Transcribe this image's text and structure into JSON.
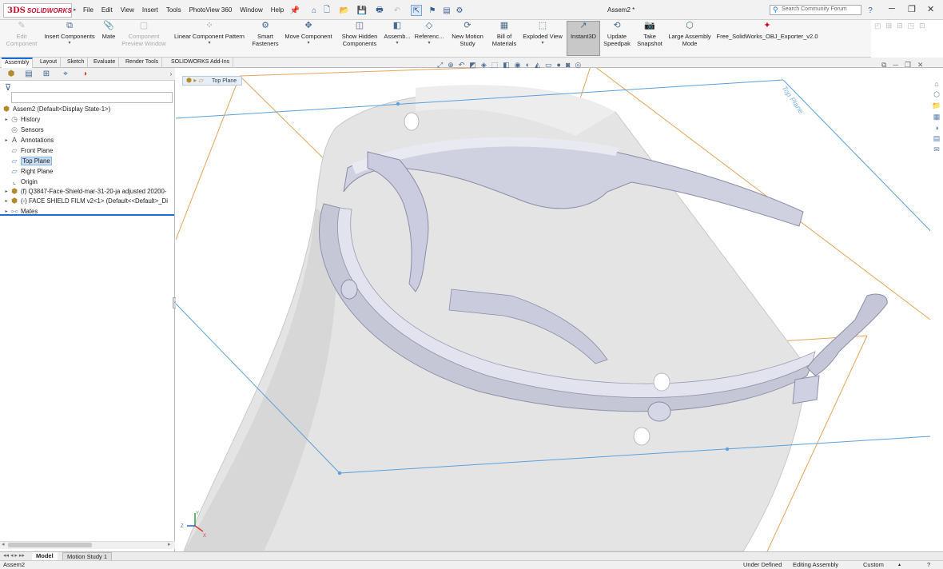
{
  "app": {
    "logo_mark": "3DS",
    "logo_text": "SOLIDWORKS",
    "doc_title": "Assem2 *"
  },
  "menu": [
    "File",
    "Edit",
    "View",
    "Insert",
    "Tools",
    "PhotoView 360",
    "Window",
    "Help"
  ],
  "search": {
    "placeholder": "Search Community Forum"
  },
  "commands": [
    {
      "label": "Edit Component",
      "icon": "edit-component-icon",
      "disabled": true
    },
    {
      "label": "Insert Components",
      "icon": "insert-components-icon"
    },
    {
      "label": "Mate",
      "icon": "mate-icon"
    },
    {
      "label": "Component Preview Window",
      "icon": "preview-window-icon",
      "disabled": true
    },
    {
      "label": "Linear Component Pattern",
      "icon": "pattern-icon"
    },
    {
      "label": "Smart Fasteners",
      "icon": "fastener-icon"
    },
    {
      "label": "Move Component",
      "icon": "move-component-icon"
    },
    {
      "label": "Show Hidden Components",
      "icon": "show-hidden-icon"
    },
    {
      "label": "Assemb...",
      "icon": "assembly-features-icon"
    },
    {
      "label": "Referenc...",
      "icon": "reference-geometry-icon"
    },
    {
      "label": "New Motion Study",
      "icon": "motion-study-icon"
    },
    {
      "label": "Bill of Materials",
      "icon": "bom-icon"
    },
    {
      "label": "Exploded View",
      "icon": "exploded-view-icon"
    },
    {
      "label": "Instant3D",
      "icon": "instant3d-icon",
      "active": true
    },
    {
      "label": "Update Speedpak",
      "icon": "speedpak-icon"
    },
    {
      "label": "Take Snapshot",
      "icon": "camera-icon"
    },
    {
      "label": "Large Assembly Mode",
      "icon": "large-assembly-icon"
    },
    {
      "label": "Free_SolidWorks_OBJ_Exporter_v2.0",
      "icon": "obj-exporter-icon"
    }
  ],
  "tabs": [
    "Assembly",
    "Layout",
    "Sketch",
    "Evaluate",
    "Render Tools",
    "SOLIDWORKS Add-Ins"
  ],
  "tree": [
    {
      "label": "Assem2  (Default<Display State-1>)",
      "icon": "assembly-icon"
    },
    {
      "label": "History",
      "icon": "history-icon"
    },
    {
      "label": "Sensors",
      "icon": "sensors-icon"
    },
    {
      "label": "Annotations",
      "icon": "annotations-icon"
    },
    {
      "label": "Front Plane",
      "icon": "plane-icon"
    },
    {
      "label": "Top Plane",
      "icon": "plane-icon",
      "selected": true
    },
    {
      "label": "Right Plane",
      "icon": "plane-icon"
    },
    {
      "label": "Origin",
      "icon": "origin-icon"
    },
    {
      "label": "(f) Q3847-Face-Shield-mar-31-20-ja adjusted 20200-",
      "icon": "part-icon"
    },
    {
      "label": "(-) FACE SHIELD FILM v2<1> (Default<<Default>_Di",
      "icon": "part-icon"
    },
    {
      "label": "Mates",
      "icon": "mates-icon"
    }
  ],
  "viewport": {
    "selected_entity": "Top Plane",
    "plane_label": "Top Plane",
    "triad": {
      "x": "X",
      "y": "Y",
      "z": "Z"
    }
  },
  "bottom_tabs": [
    "Model",
    "Motion Study 1"
  ],
  "status": {
    "doc": "Assem2",
    "definition": "Under Defined",
    "mode": "Editing Assembly",
    "units": "Custom"
  }
}
